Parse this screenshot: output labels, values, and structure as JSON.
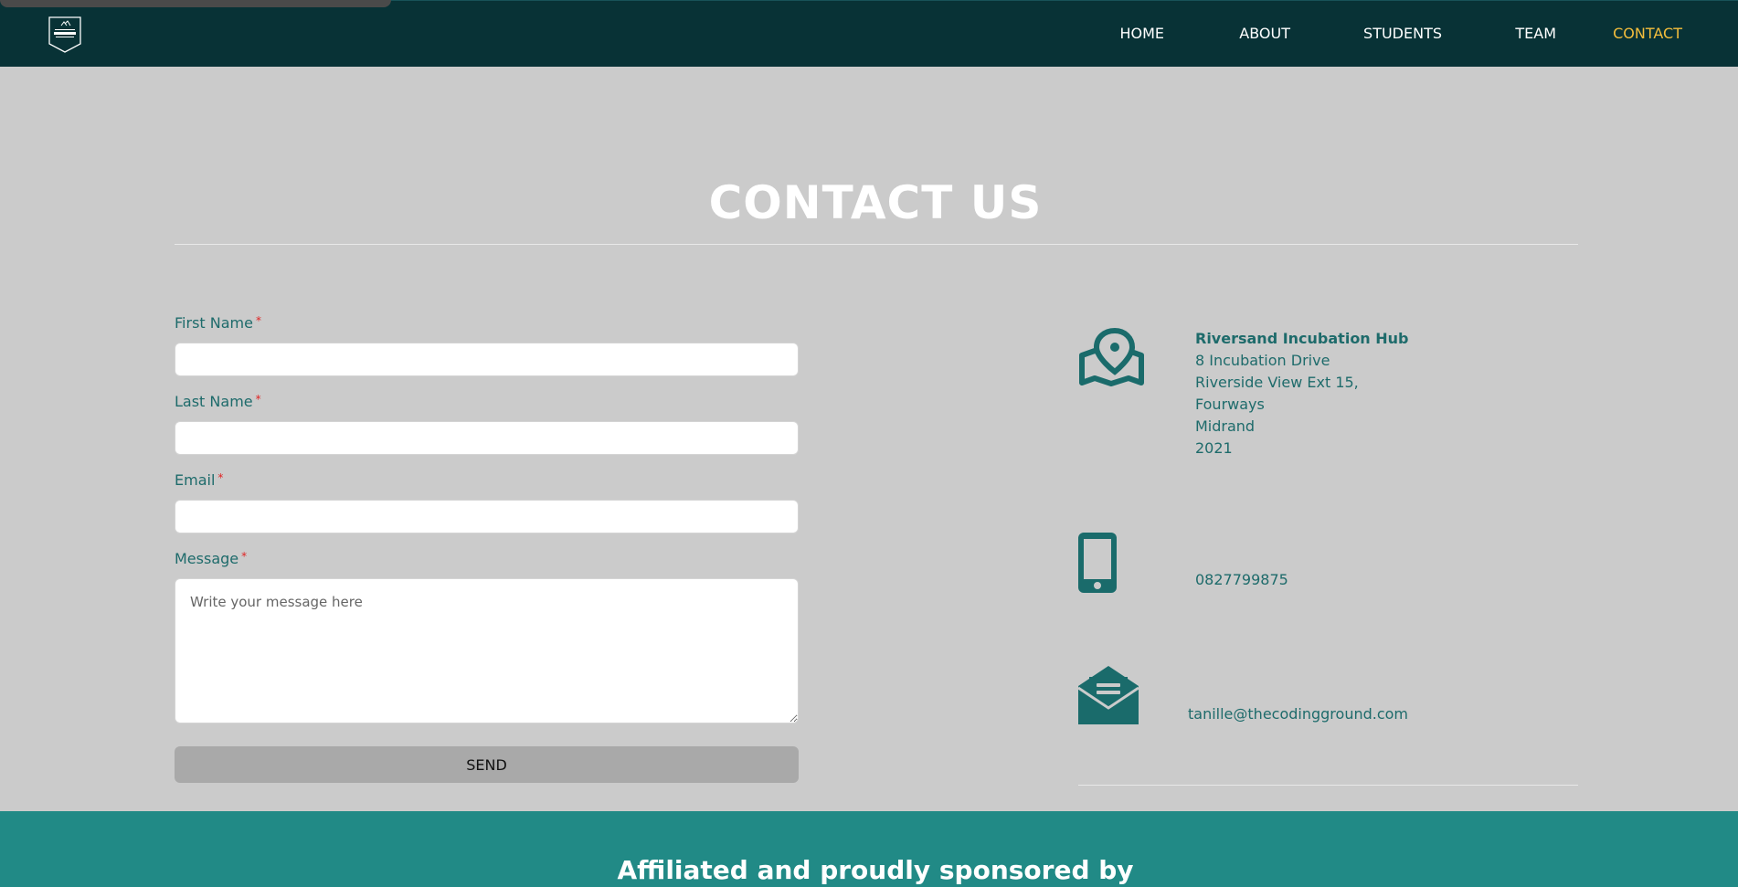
{
  "header": {
    "logo_alt": "The Coding Ground logo",
    "nav": [
      {
        "label": "HOME"
      },
      {
        "label": "ABOUT"
      },
      {
        "label": "STUDENTS"
      },
      {
        "label": "TEAM"
      },
      {
        "label": "CONTACT",
        "active": true
      }
    ]
  },
  "main": {
    "title": "CONTACT US"
  },
  "form": {
    "required_marker": "*",
    "first_name": {
      "label": "First Name",
      "value": "",
      "placeholder": ""
    },
    "last_name": {
      "label": "Last Name",
      "value": "",
      "placeholder": ""
    },
    "email": {
      "label": "Email",
      "value": "",
      "placeholder": ""
    },
    "message": {
      "label": "Message",
      "value": "",
      "placeholder": "Write your message here"
    },
    "send_label": "SEND"
  },
  "contact_info": {
    "address": {
      "icon": "map-pin-icon",
      "name": "Riversand Incubation Hub",
      "line1": "8 Incubation Drive",
      "line2": "Riverside View Ext 15,",
      "line3": "Fourways",
      "line4": "Midrand",
      "line5": "2021"
    },
    "phone": {
      "icon": "mobile-phone-icon",
      "value": "0827799875"
    },
    "email": {
      "icon": "envelope-open-icon",
      "value": "tanille@thecodingground.com"
    }
  },
  "footer": {
    "heading": "Affiliated and proudly sponsored by"
  },
  "colors": {
    "header_bg": "#083236",
    "accent": "#f4be3c",
    "teal_text": "#1e6b6b",
    "footer_bg": "#218a86",
    "page_bg": "#cbcbcb"
  }
}
